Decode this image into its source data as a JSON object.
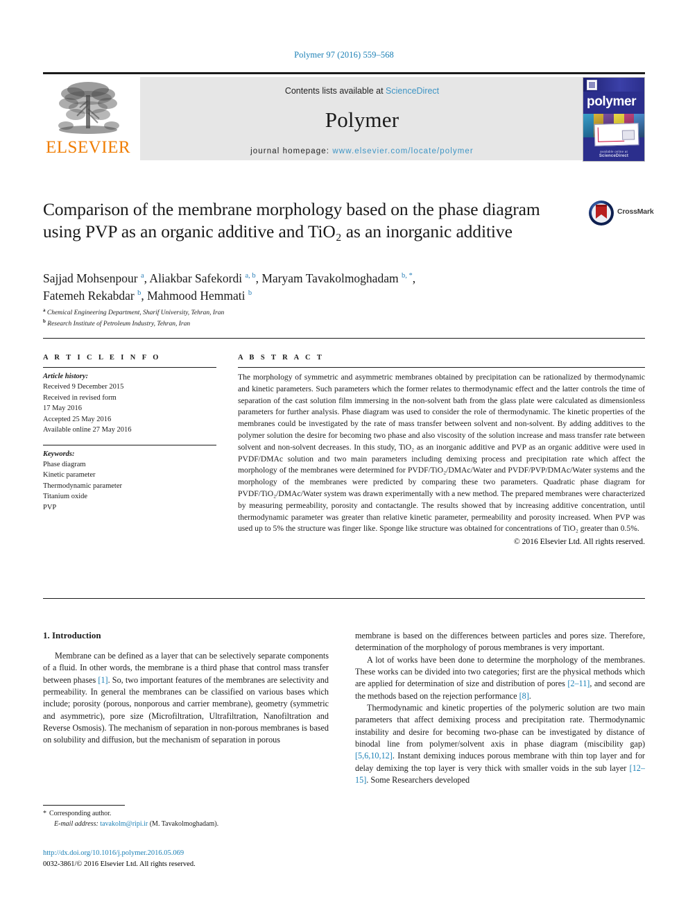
{
  "running_head": "Polymer 97 (2016) 559–568",
  "masthead": {
    "publisher_word": "ELSEVIER",
    "contents_prefix": "Contents lists available at ",
    "contents_link": "ScienceDirect",
    "journal_name": "Polymer",
    "homepage_label": "journal homepage: ",
    "homepage_url": "www.elsevier.com/locate/polymer",
    "cover": {
      "title": "polymer",
      "footer_small": "available online at",
      "footer_bold": "ScienceDirect"
    }
  },
  "crossmark": {
    "label": "CrossMark"
  },
  "article": {
    "title": "Comparison of the membrane morphology based on the phase diagram using PVP as an organic additive and TiO₂ as an inorganic additive",
    "authors_line1_a": "Sajjad Mohsenpour ",
    "authors_sup_a": "a",
    "authors_line1_b": ", Aliakbar Safekordi ",
    "authors_sup_b": "a, b",
    "authors_line1_c": ", Maryam Tavakolmoghadam ",
    "authors_sup_c": "b, *",
    "authors_line2_a": "Fatemeh Rekabdar ",
    "authors_sup_d": "b",
    "authors_line2_b": ", Mahmood Hemmati ",
    "authors_sup_e": "b",
    "affiliation_a_sup": "a",
    "affiliation_a": " Chemical Engineering Department, Sharif University, Tehran, Iran",
    "affiliation_b_sup": "b",
    "affiliation_b": " Research Institute of Petroleum Industry, Tehran, Iran"
  },
  "article_info": {
    "heading": "A R T I C L E   I N F O",
    "history_label": "Article history:",
    "history": [
      "Received 9 December 2015",
      "Received in revised form",
      "17 May 2016",
      "Accepted 25 May 2016",
      "Available online 27 May 2016"
    ],
    "keywords_label": "Keywords:",
    "keywords": [
      "Phase diagram",
      "Kinetic parameter",
      "Thermodynamic parameter",
      "Titanium oxide",
      "PVP"
    ]
  },
  "abstract": {
    "heading": "A B S T R A C T",
    "text": "The morphology of symmetric and asymmetric membranes obtained by precipitation can be rationalized by thermodynamic and kinetic parameters. Such parameters which the former relates to thermodynamic effect and the latter controls the time of separation of the cast solution film immersing in the non-solvent bath from the glass plate were calculated as dimensionless parameters for further analysis. Phase diagram was used to consider the role of thermodynamic. The kinetic properties of the membranes could be investigated by the rate of mass transfer between solvent and non-solvent. By adding additives to the polymer solution the desire for becoming two phase and also viscosity of the solution increase and mass transfer rate between solvent and non-solvent decreases. In this study, TiO₂ as an inorganic additive and PVP as an organic additive were used in PVDF/DMAc solution and two main parameters including demixing process and precipitation rate which affect the morphology of the membranes were determined for PVDF/TiO₂/DMAc/Water and PVDF/PVP/DMAc/Water systems and the morphology of the membranes were predicted by comparing these two parameters. Quadratic phase diagram for PVDF/TiO₂/DMAc/Water system was drawn experimentally with a new method. The prepared membranes were characterized by measuring permeability, porosity and contactangle. The results showed that by increasing additive concentration, until thermodynamic parameter was greater than relative kinetic parameter, permeability and porosity increased. When PVP was used up to 5% the structure was finger like. Sponge like structure was obtained for concentrations of TiO₂ greater than 0.5%.",
    "copyright": "© 2016 Elsevier Ltd. All rights reserved."
  },
  "introduction": {
    "heading": "1. Introduction",
    "left_p1_a": "Membrane can be defined as a layer that can be selectively separate components of a fluid. In other words, the membrane is a third phase that control mass transfer between phases ",
    "left_p1_cit1": "[1]",
    "left_p1_b": ". So, two important features of the membranes are selectivity and permeability. In general the membranes can be classified on various bases which include; porosity (porous, nonporous and carrier membrane), geometry (symmetric and asymmetric), pore size (Microfiltration, Ultrafiltration, Nanofiltration and Reverse Osmosis). The mechanism of separation in non-porous membranes is based on solubility and diffusion, but the mechanism of separation in porous",
    "right_p1": "membrane is based on the differences between particles and pores size. Therefore, determination of the morphology of porous membranes is very important.",
    "right_p2_a": "A lot of works have been done to determine the morphology of the membranes. These works can be divided into two categories; first are the physical methods which are applied for determination of size and distribution of pores ",
    "right_p2_cit1": "[2–11]",
    "right_p2_b": ", and second are the methods based on the rejection performance ",
    "right_p2_cit2": "[8]",
    "right_p2_c": ".",
    "right_p3_a": "Thermodynamic and kinetic properties of the polymeric solution are two main parameters that affect demixing process and precipitation rate. Thermodynamic instability and desire for becoming two-phase can be investigated by distance of binodal line from polymer/solvent axis in phase diagram (miscibility gap) ",
    "right_p3_cit1": "[5,6,10,12]",
    "right_p3_b": ". Instant demixing induces porous membrane with thin top layer and for delay demixing the top layer is very thick with smaller voids in the sub layer ",
    "right_p3_cit2": "[12–15]",
    "right_p3_c": ". Some Researchers developed"
  },
  "footnote": {
    "star": "*",
    "corresponding": "Corresponding author.",
    "email_label": "E-mail address:",
    "email": "tavakolm@ripi.ir",
    "email_owner": "(M. Tavakolmoghadam)."
  },
  "publication": {
    "doi": "http://dx.doi.org/10.1016/j.polymer.2016.05.069",
    "issn_line": "0032-3861/© 2016 Elsevier Ltd. All rights reserved."
  },
  "colors": {
    "link": "#1a7fb5",
    "elsevier_orange": "#f07d00",
    "cover_blue": "#2b2e8c",
    "band_gray": "#e6e6e6"
  }
}
